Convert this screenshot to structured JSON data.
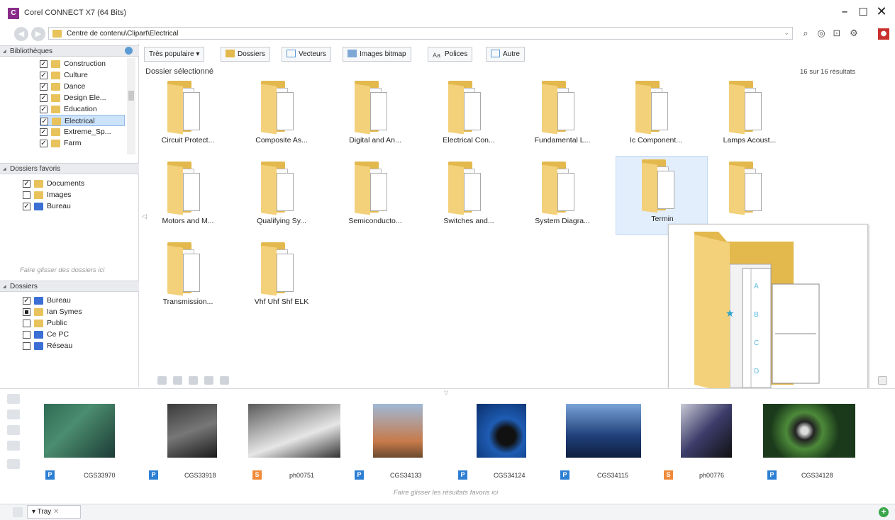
{
  "window": {
    "title": "Corel CONNECT X7 (64 Bits)",
    "icon": "corel-connect-icon"
  },
  "address": {
    "path": "Centre de contenu\\Clipart\\Electrical"
  },
  "libraries": {
    "header": "Bibliothèques",
    "items": [
      {
        "label": "Construction",
        "checked": true
      },
      {
        "label": "Culture",
        "checked": true
      },
      {
        "label": "Dance",
        "checked": true
      },
      {
        "label": "Design Ele...",
        "checked": true
      },
      {
        "label": "Education",
        "checked": true
      },
      {
        "label": "Electrical",
        "checked": true,
        "selected": true
      },
      {
        "label": "Extreme_Sp...",
        "checked": true
      },
      {
        "label": "Farm",
        "checked": true
      }
    ]
  },
  "favorites": {
    "header": "Dossiers favoris",
    "items": [
      {
        "label": "Documents",
        "checked": true
      },
      {
        "label": "Images",
        "checked": false
      },
      {
        "label": "Bureau",
        "checked": true
      }
    ],
    "hint": "Faire glisser des dossiers ici"
  },
  "folders_panel": {
    "header": "Dossiers",
    "items": [
      {
        "label": "Bureau",
        "checked": true
      },
      {
        "label": "Ian Symes",
        "checked": "partial"
      },
      {
        "label": "Public",
        "checked": false
      },
      {
        "label": "Ce PC",
        "checked": false
      },
      {
        "label": "Réseau",
        "checked": false
      }
    ]
  },
  "filters": {
    "popular": "Très populaire",
    "folders": "Dossiers",
    "vectors": "Vecteurs",
    "bitmaps": "Images bitmap",
    "fonts": "Polices",
    "other": "Autre"
  },
  "content": {
    "section_label": "Dossier sélectionné",
    "results": "16 sur 16 résultats",
    "folders": [
      "Circuit Protect...",
      "Composite As...",
      "Digital and An...",
      "Electrical Con...",
      "Fundamental L...",
      "Ic Component...",
      "Lamps Acoust...",
      "Motors and M...",
      "Qualifying Sy...",
      "Semiconducto...",
      "Switches and...",
      "System Diagra...",
      "Termin",
      "",
      "Transmission...",
      "Vhf Uhf Shf ELK"
    ]
  },
  "tray": {
    "hint": "Faire glisser les résultats favoris ici",
    "tab_label": "Tray",
    "items": [
      {
        "badge": "P",
        "name": "CGS33970"
      },
      {
        "badge": "P",
        "name": "CGS33918"
      },
      {
        "badge": "S",
        "name": "ph00751"
      },
      {
        "badge": "P",
        "name": "CGS34133"
      },
      {
        "badge": "P",
        "name": "CGS34124"
      },
      {
        "badge": "P",
        "name": "CGS34115"
      },
      {
        "badge": "S",
        "name": "ph00776"
      },
      {
        "badge": "P",
        "name": "CGS34128"
      }
    ]
  },
  "colors": {
    "folder": "#e3b84c",
    "selection": "#e3eefc",
    "badge_p": "#2d7fd3",
    "badge_s": "#f08a3a"
  }
}
